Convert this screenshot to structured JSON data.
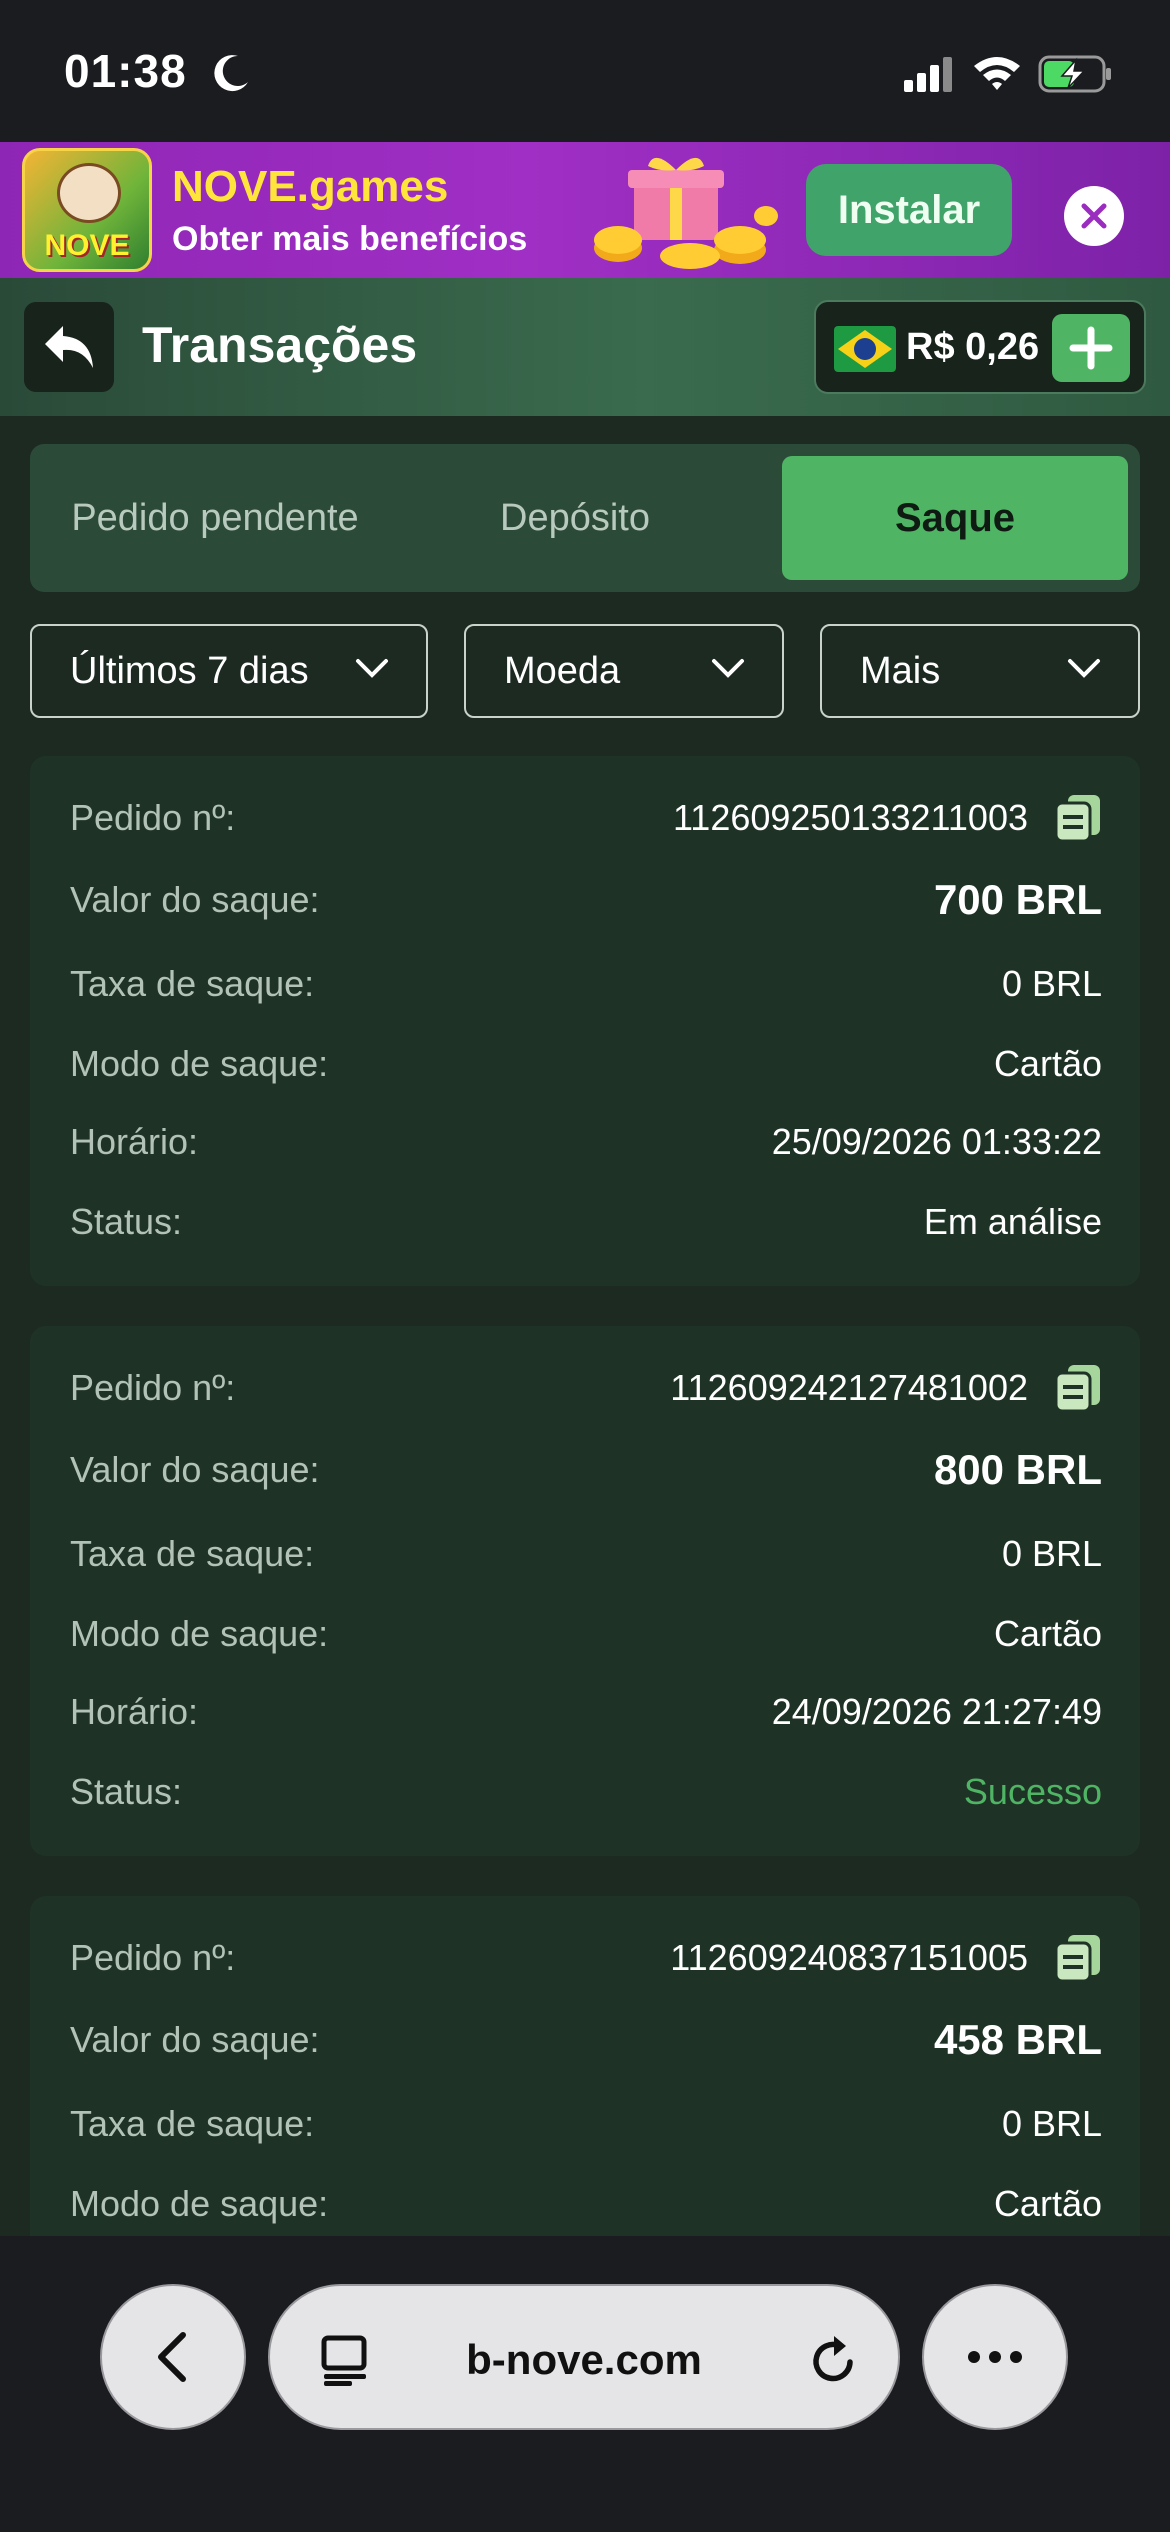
{
  "status_bar": {
    "time": "01:38"
  },
  "promo": {
    "logo_text": "NOVE",
    "title": "NOVE.games",
    "subtitle": "Obter mais benefícios",
    "install_label": "Instalar"
  },
  "header": {
    "title": "Transações",
    "balance": "R$ 0,26"
  },
  "tabs": [
    {
      "label": "Pedido pendente"
    },
    {
      "label": "Depósito"
    },
    {
      "label": "Saque",
      "active": true
    }
  ],
  "filters": [
    {
      "label": "Últimos 7 dias"
    },
    {
      "label": "Moeda"
    },
    {
      "label": "Mais"
    }
  ],
  "labels": {
    "order": "Pedido nº:",
    "amount": "Valor do saque:",
    "fee": "Taxa de saque:",
    "mode": "Modo de saque:",
    "time": "Horário:",
    "status": "Status:"
  },
  "transactions": [
    {
      "order": "112609250133211003",
      "amount": "700 BRL",
      "fee": "0 BRL",
      "mode": "Cartão",
      "time": "25/09/2026 01:33:22",
      "status": "Em análise"
    },
    {
      "order": "112609242127481002",
      "amount": "800 BRL",
      "fee": "0 BRL",
      "mode": "Cartão",
      "time": "24/09/2026 21:27:49",
      "status": "Sucesso"
    },
    {
      "order": "112609240837151005",
      "amount": "458 BRL",
      "fee": "0 BRL",
      "mode": "Cartão"
    }
  ],
  "browser": {
    "url": "b-nove.com"
  },
  "colors": {
    "accent_green": "#4fb565",
    "card_bg": "#1f3226",
    "promo_purple": "#9a2cc0",
    "promo_yellow": "#ffe53b"
  }
}
